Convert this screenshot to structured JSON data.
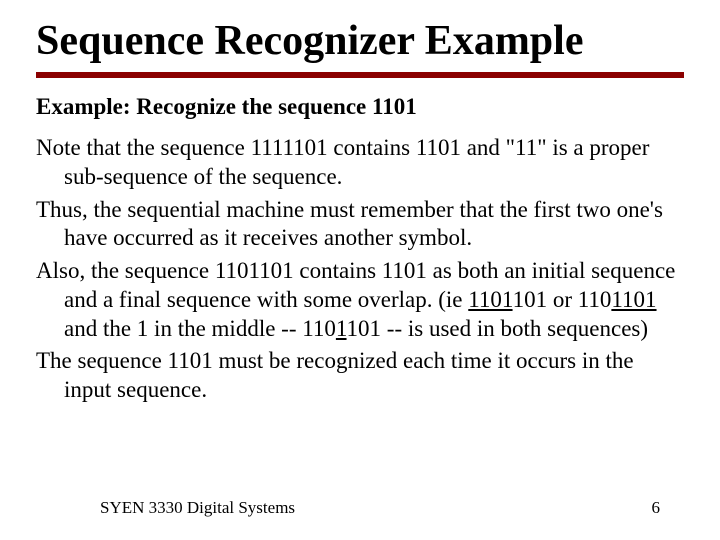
{
  "title": "Sequence Recognizer Example",
  "intro": "Example:  Recognize the sequence 1101",
  "body": {
    "p1a": "Note that the sequence 1111101 contains 1101 and \"11\" is a proper sub-sequence of the sequence.",
    "p2a": "Thus, the sequential machine must remember that the first two one's have occurred as it receives another symbol.",
    "p3_pre": "Also, the sequence 1101101 contains 1101 as both an initial sequence and a final sequence with some overlap. (ie ",
    "p3_u1": "1101",
    "p3_mid1": "101   or 110",
    "p3_u2": "1101",
    "p3_mid2": " and the 1 in the middle  -- 110",
    "p3_u3": "1",
    "p3_post": "101 -- is used in both sequences)",
    "p4a": "The sequence 1101 must be recognized each time it occurs in the input sequence."
  },
  "footer": {
    "left": "SYEN 3330  Digital Systems",
    "right": "6"
  }
}
